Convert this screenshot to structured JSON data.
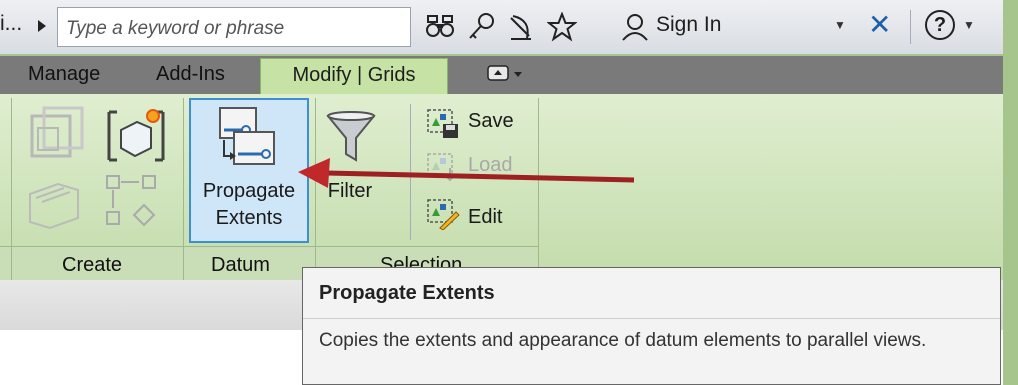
{
  "infobar": {
    "truncated_text": "i...",
    "search_placeholder": "Type a keyword or phrase",
    "sign_in": "Sign In",
    "help": "?"
  },
  "tabs": {
    "manage": "Manage",
    "addins": "Add-Ins",
    "modify_grids": "Modify | Grids"
  },
  "ribbon": {
    "create_label": "Create",
    "datum_label": "Datum",
    "selection_label": "Selection",
    "propagate_line1": "Propagate",
    "propagate_line2": "Extents",
    "filter": "Filter",
    "save": "Save",
    "load": "Load",
    "edit": "Edit"
  },
  "tooltip": {
    "title": "Propagate Extents",
    "body": "Copies the extents and appearance of datum elements to parallel views."
  },
  "colors": {
    "frame_green": "#a5c58c",
    "active_tab": "#c6e2a5",
    "highlight_blue": "#3c8fd5",
    "annotation_red": "#c0282a"
  },
  "icons": [
    "binoculars-icon",
    "key-icon",
    "satellite-icon",
    "star-icon",
    "user-icon",
    "exchange-x-icon",
    "help-icon",
    "filter-funnel-icon",
    "save-icon",
    "load-icon",
    "edit-icon",
    "propagate-extents-icon"
  ]
}
